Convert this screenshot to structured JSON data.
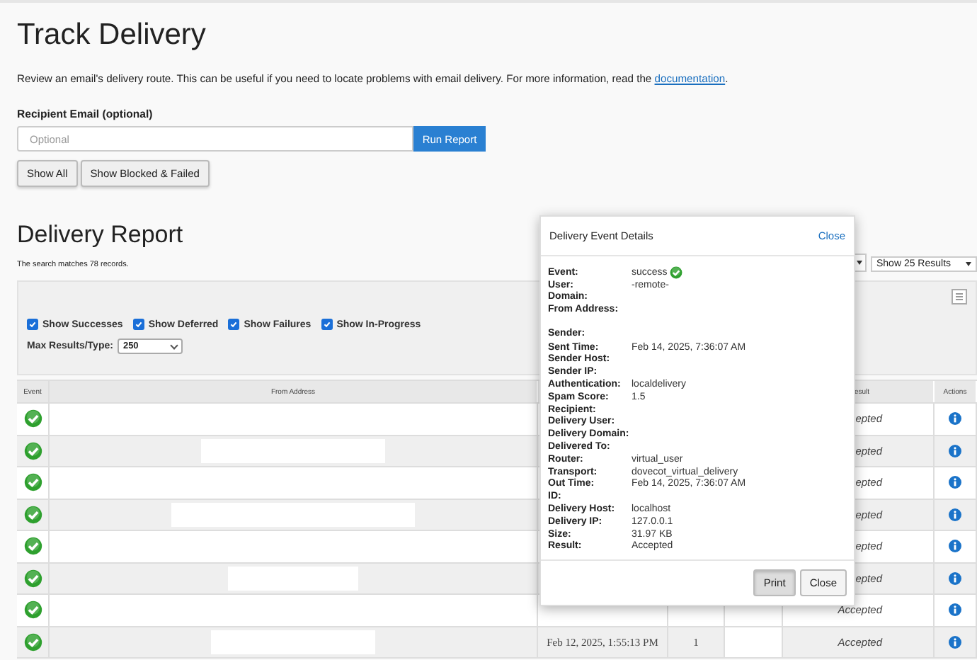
{
  "page": {
    "title": "Track Delivery",
    "description_before": "Review an email's delivery route. This can be useful if you need to locate problems with email delivery. For more information, read the",
    "link": "documentation",
    "description_after": "."
  },
  "recipient": {
    "label": "Recipient Email (optional)",
    "placeholder": "Optional",
    "run_button": "Run Report"
  },
  "filter_buttons": [
    "Show All",
    "Show Blocked & Failed"
  ],
  "report": {
    "title": "Delivery Report",
    "summary": "The search matches 78 records.",
    "results_select": "Show 25 Results"
  },
  "filters": [
    {
      "label": "Show Successes",
      "checked": true
    },
    {
      "label": "Show Deferred",
      "checked": true
    },
    {
      "label": "Show Failures",
      "checked": true
    },
    {
      "label": "Show In-Progress",
      "checked": true
    }
  ],
  "max_results": {
    "label": "Max Results/Type:",
    "value": "250"
  },
  "table": {
    "columns": [
      {
        "label": "Event"
      },
      {
        "label": "From Address"
      },
      {
        "label": "esult"
      },
      {
        "label": "Actions"
      }
    ],
    "rows": [
      {
        "kind": "success",
        "result": "epted"
      },
      {
        "kind": "success",
        "result": "epted"
      },
      {
        "kind": "success",
        "result": "epted"
      },
      {
        "kind": "success",
        "result": "epted"
      },
      {
        "kind": "success",
        "result": "epted"
      },
      {
        "kind": "success",
        "result": "epted"
      },
      {
        "kind": "success",
        "result": "Accepted"
      },
      {
        "kind": "success",
        "date": "Feb 12, 2025, 1:55:13 PM",
        "count": "1",
        "result": "Accepted"
      }
    ]
  },
  "modal": {
    "title": "Delivery Event Details",
    "close_link": "Close",
    "details": [
      {
        "label": "Event:",
        "value": "success",
        "kind": "success"
      },
      {
        "label": "User:",
        "value": "-remote-"
      },
      {
        "label": "Domain:"
      },
      {
        "label": "From Address:"
      },
      {
        "label": "Sender:",
        "gap_before": true
      },
      {
        "label": "Sent Time:",
        "value": "Feb 14, 2025, 7:36:07 AM"
      },
      {
        "label": "Sender Host:"
      },
      {
        "label": "Sender IP:"
      },
      {
        "label": "Authentication:",
        "value": "localdelivery"
      },
      {
        "label": "Spam Score:",
        "value": "1.5"
      },
      {
        "label": "Recipient:"
      },
      {
        "label": "Delivery User:"
      },
      {
        "label": "Delivery Domain:"
      },
      {
        "label": "Delivered To:"
      },
      {
        "label": "Router:",
        "value": "virtual_user"
      },
      {
        "label": "Transport:",
        "value": "dovecot_virtual_delivery"
      },
      {
        "label": "Out Time:",
        "value": "Feb 14, 2025, 7:36:07 AM"
      },
      {
        "label": "ID:"
      },
      {
        "label": "Delivery Host:",
        "value": "localhost"
      },
      {
        "label": "Delivery IP:",
        "value": "127.0.0.1"
      },
      {
        "label": "Size:",
        "value": "31.97 KB"
      },
      {
        "label": "Result:",
        "value": "Accepted"
      }
    ],
    "buttons": [
      {
        "label": "Print",
        "pressed": true
      },
      {
        "label": "Close",
        "pressed": false
      }
    ]
  }
}
